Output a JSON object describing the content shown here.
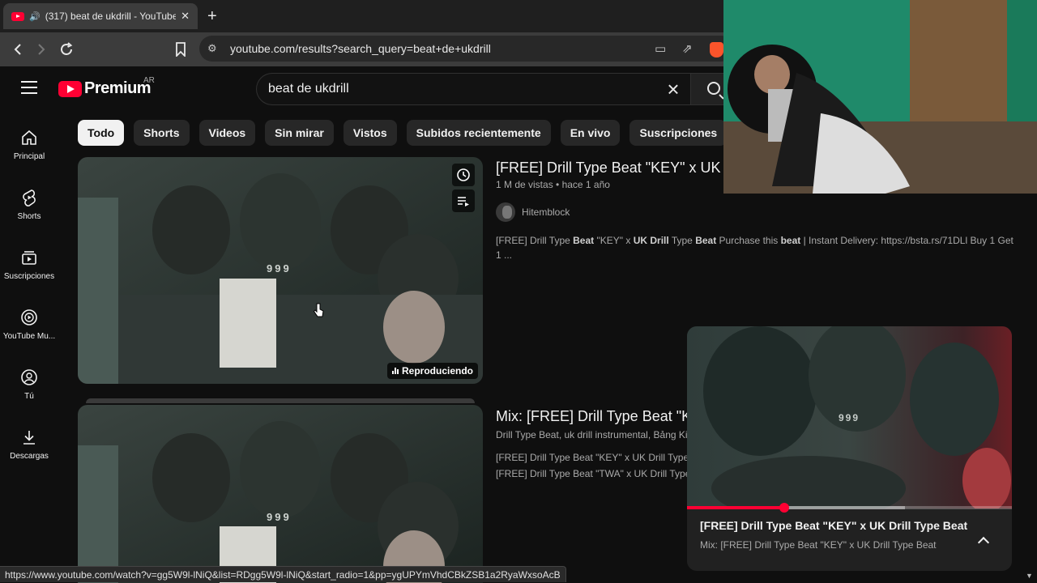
{
  "browser": {
    "tab_title": "(317) beat de ukdrill - YouTube",
    "url": "youtube.com/results?search_query=beat+de+ukdrill",
    "new_tab": "+",
    "close": "✕"
  },
  "masthead": {
    "logo_text": "Premium",
    "country_code": "AR",
    "search_query": "beat de ukdrill"
  },
  "sidebar": {
    "items": [
      {
        "label": "Principal",
        "icon": "home-icon"
      },
      {
        "label": "Shorts",
        "icon": "shorts-icon"
      },
      {
        "label": "Suscripciones",
        "icon": "subscriptions-icon"
      },
      {
        "label": "YouTube Mu...",
        "icon": "youtube-music-icon"
      },
      {
        "label": "Tú",
        "icon": "you-icon"
      },
      {
        "label": "Descargas",
        "icon": "download-icon"
      }
    ]
  },
  "chips": [
    "Todo",
    "Shorts",
    "Videos",
    "Sin mirar",
    "Vistos",
    "Subidos recientemente",
    "En vivo",
    "Suscripciones"
  ],
  "results": [
    {
      "title": "[FREE] Drill Type Beat \"KEY\" x UK Drill Type Beat",
      "meta": "1 M de vistas • hace 1 año",
      "channel": "Hitemblock",
      "desc_parts": [
        "[FREE] Drill Type ",
        "Beat",
        " \"KEY\" x ",
        "UK Drill",
        " Type ",
        "Beat",
        " Purchase this ",
        "beat",
        " | Instant Delivery: https://bsta.rs/71DLl Buy 1 Get"
      ],
      "desc_line2": "1 ...",
      "badge": "Reproduciendo",
      "thumb_text": "999"
    },
    {
      "title": "Mix: [FREE] Drill Type Beat \"KEY\" x UK Drill Type Beat",
      "meta": "Drill Type Beat, uk drill instrumental, Bảng Kiều",
      "desc_line1": "[FREE] Drill Type Beat \"KEY\" x UK Drill Type Beat",
      "desc_line2": "[FREE] Drill Type Beat \"TWA\" x UK Drill Type Beat",
      "thumb_text": "999"
    }
  ],
  "miniplayer": {
    "title": "[FREE] Drill Type Beat \"KEY\" x UK Drill Type Beat",
    "subtitle": "Mix: [FREE] Drill Type Beat \"KEY\" x UK Drill Type Beat",
    "progress_fraction": 0.3,
    "buffered_fraction": 0.67,
    "video_text": "999"
  },
  "status_url": "https://www.youtube.com/watch?v=gg5W9l-lNiQ&list=RDgg5W9l-lNiQ&start_radio=1&pp=ygUPYmVhdCBkZSB1a2RyaWxsoAcB",
  "colors": {
    "accent": "#ff0033",
    "background": "#0f0f0f",
    "chip": "#272727"
  }
}
